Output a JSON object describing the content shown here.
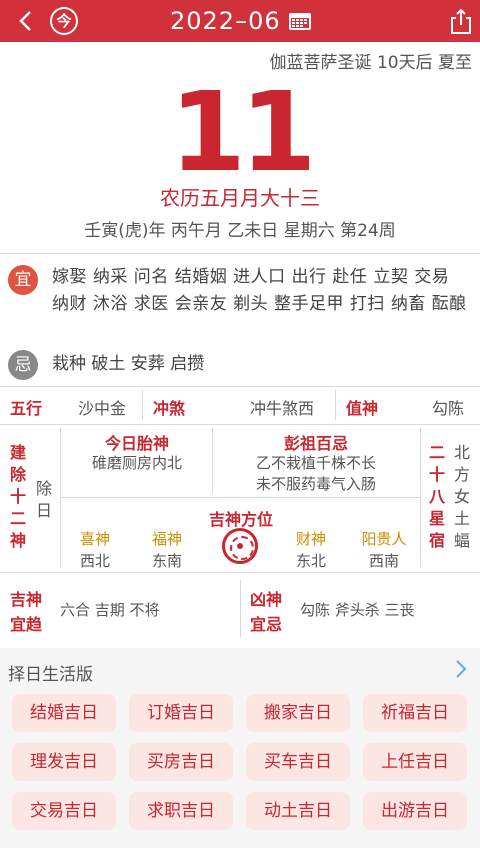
{
  "header": {
    "today_label": "今",
    "title": "2022–06",
    "icons": {
      "back": "back-chevron-icon",
      "calendar": "calendar-icon",
      "share": "share-icon"
    },
    "color": "#d0313b"
  },
  "festivals": "伽蓝菩萨圣诞  10天后 夏至",
  "day_number": "11",
  "lunar_date": "农历五月月大十三",
  "ganzhi": "壬寅(虎)年 丙午月 乙未日 星期六 第24周",
  "yi": {
    "badge": "宜",
    "items": "嫁娶 纳采 问名 结婚姻 进人口 出行 赴任 立契 交易 纳财 沐浴 求医 会亲友 剃头 整手足甲 打扫 纳畜 酝酿"
  },
  "ji": {
    "badge": "忌",
    "items": "栽种 破土 安葬 启攒"
  },
  "info_row": {
    "wuxing_label": "五行",
    "wuxing_value": "沙中金",
    "chongsha_label": "冲煞",
    "chongsha_value": "冲牛煞西",
    "zhishen_label": "值神",
    "zhishen_value": "勾陈"
  },
  "jianchu": {
    "label": "建除十二神",
    "value": "除日"
  },
  "taishen": {
    "title": "今日胎神",
    "value": "碓磨厕房内北"
  },
  "pengzu": {
    "title": "彭祖百忌",
    "line1": "乙不栽植千株不长",
    "line2": "未不服药毒气入肠"
  },
  "xiu": {
    "label": "二十八星宿",
    "value": "北方女土蝠"
  },
  "jishen_fangwei": {
    "title": "吉神方位",
    "xi_label": "喜神",
    "xi_dir": "西北",
    "fu_label": "福神",
    "fu_dir": "东南",
    "cai_label": "财神",
    "cai_dir": "东北",
    "yang_label": "阳贵人",
    "yang_dir": "西南"
  },
  "jishen_yiqu": {
    "label1": "吉神",
    "label2": "宜趋",
    "value": "六合 吉期 不将"
  },
  "xiongshen_yiji": {
    "label1": "凶神",
    "label2": "宜忌",
    "value": "勾陈 斧头杀 三丧"
  },
  "life_section": {
    "title": "择日生活版",
    "buttons": [
      "结婚吉日",
      "订婚吉日",
      "搬家吉日",
      "祈福吉日",
      "理发吉日",
      "买房吉日",
      "买车吉日",
      "上任吉日",
      "交易吉日",
      "求职吉日",
      "动土吉日",
      "出游吉日"
    ]
  }
}
